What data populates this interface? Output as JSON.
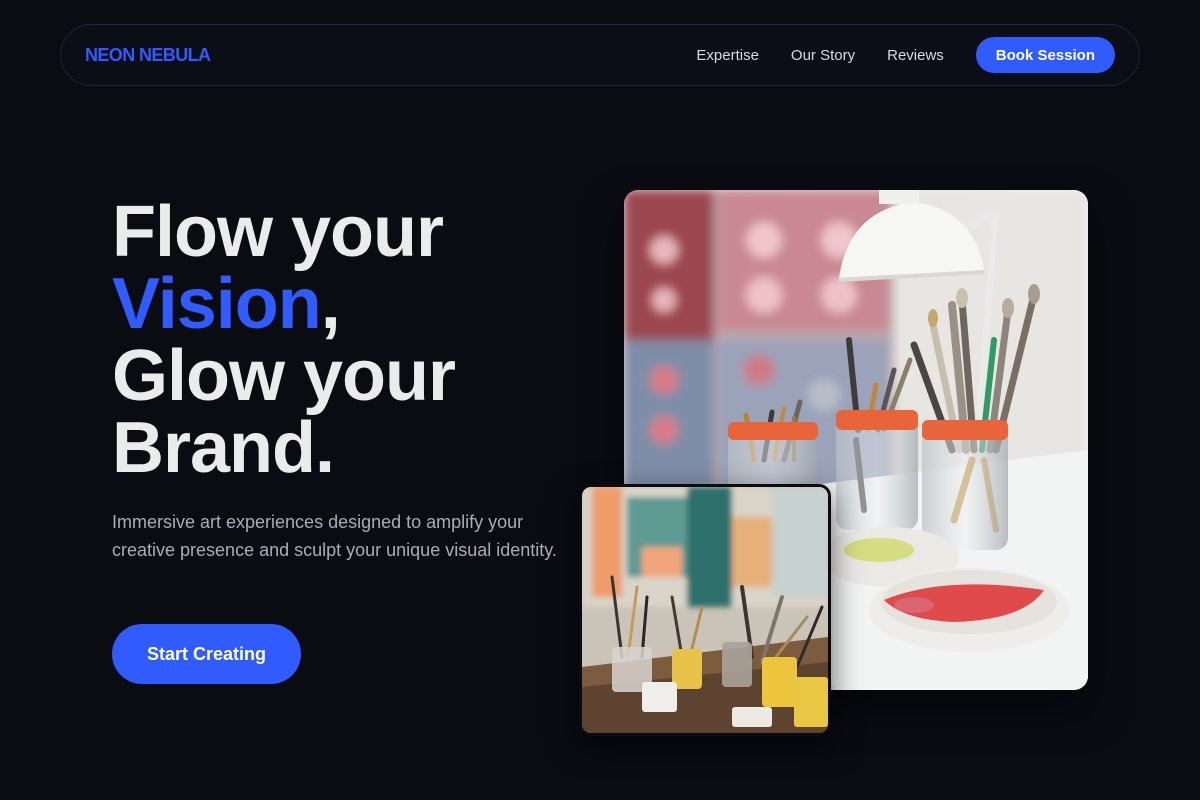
{
  "brand": {
    "logo": "NEON NEBULA",
    "accent_color": "#2f5bff"
  },
  "nav": {
    "links": [
      "Expertise",
      "Our Story",
      "Reviews"
    ],
    "cta": "Book Session"
  },
  "hero": {
    "line1": "Flow your",
    "accent_word": "Vision",
    "accent_punct": ",",
    "line3": "Glow your",
    "line4": "Brand.",
    "subtitle": "Immersive art experiences designed to amplify your creative presence and sculpt your unique visual identity.",
    "cta": "Start Creating"
  },
  "images": {
    "main": {
      "icon": "photo-paintbrush-jars-icon"
    },
    "secondary": {
      "icon": "photo-studio-table-icon"
    }
  }
}
